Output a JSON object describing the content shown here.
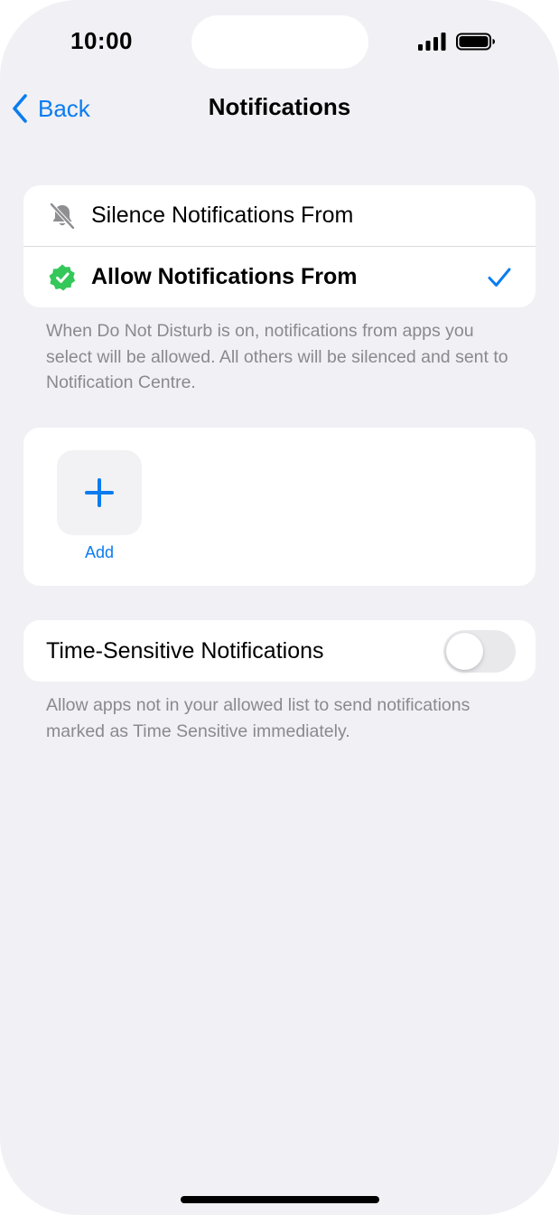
{
  "status_bar": {
    "time": "10:00"
  },
  "nav": {
    "back_label": "Back",
    "title": "Notifications"
  },
  "mode_options": {
    "silence_label": "Silence Notifications From",
    "allow_label": "Allow Notifications From",
    "selected": "allow"
  },
  "mode_caption": "When Do Not Disturb is on, notifications from apps you select will be allowed. All others will be silenced and sent to Notification Centre.",
  "apps": {
    "add_label": "Add"
  },
  "time_sensitive": {
    "label": "Time-Sensitive Notifications",
    "enabled": false,
    "caption": "Allow apps not in your allowed list to send notifications marked as Time Sensitive immediately."
  },
  "colors": {
    "accent": "#0a7cf0",
    "allow_badge": "#34c759",
    "background": "#f0f0f5"
  },
  "icons": {
    "silence": "bell-slash-icon",
    "allow": "checkmark-seal-icon",
    "selected": "checkmark-icon",
    "add": "plus-icon",
    "back": "chevron-left-icon"
  }
}
